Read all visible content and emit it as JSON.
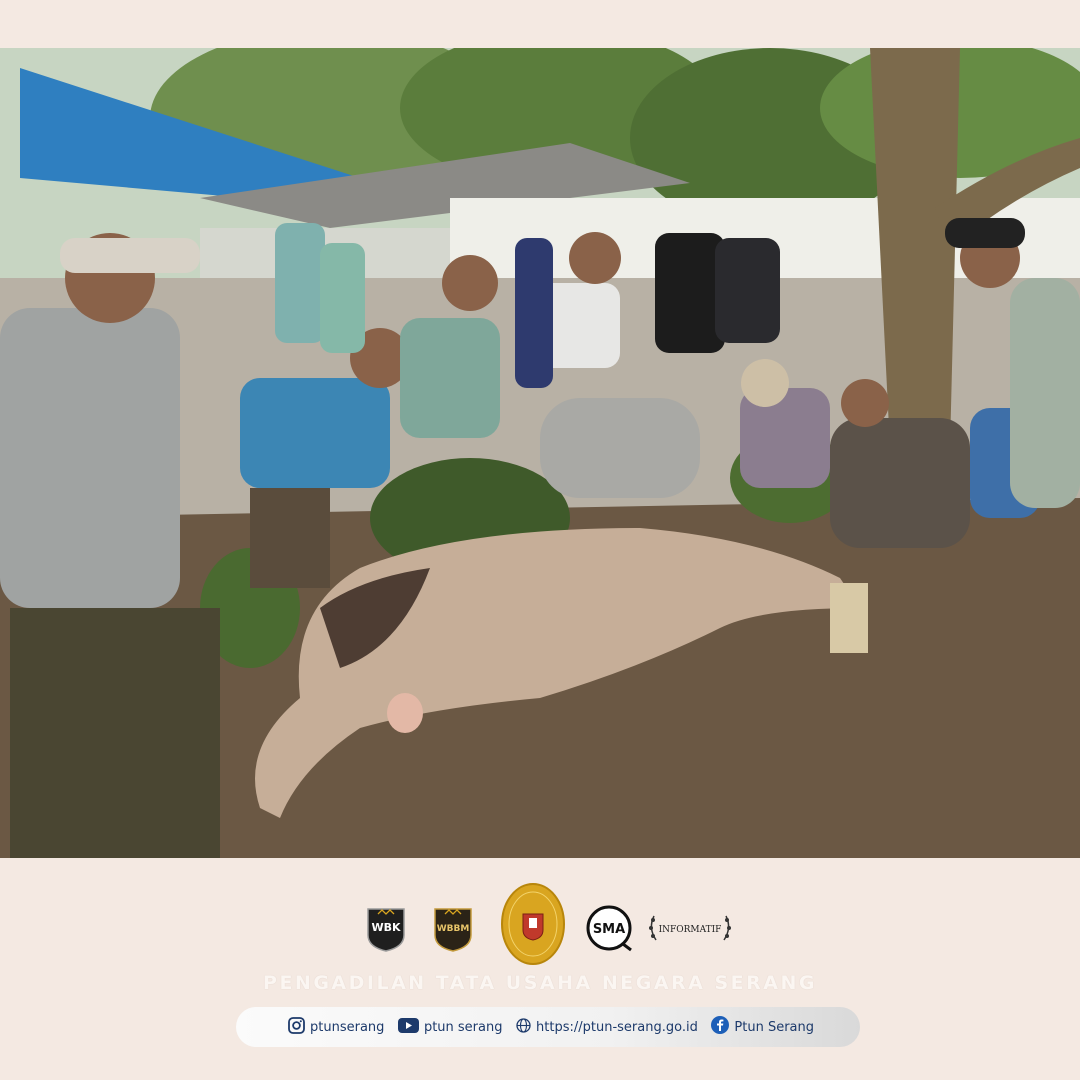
{
  "photo": {
    "subject": "group-photo",
    "accent_colors": {
      "tarp": "#2f7fc0",
      "sky": "#e3ece6",
      "foliage": "#5f7b3c",
      "ground": "#6a5a45",
      "cow": "#c9b3a0"
    }
  },
  "logos": [
    {
      "name": "wbk-badge",
      "text": "WBK"
    },
    {
      "name": "wbbm-badge",
      "text": "WBBM"
    },
    {
      "name": "court-seal",
      "text": ""
    },
    {
      "name": "sma-badge",
      "text": "SMA"
    },
    {
      "name": "informatif-badge",
      "text": "INFORMATIF"
    }
  ],
  "organization": {
    "name": "PENGADILAN TATA USAHA NEGARA SERANG"
  },
  "social": {
    "instagram": {
      "icon": "instagram-icon",
      "label": "ptunserang"
    },
    "youtube": {
      "icon": "youtube-icon",
      "label": "ptun serang"
    },
    "website": {
      "icon": "globe-icon",
      "label": "https://ptun-serang.go.id"
    },
    "facebook": {
      "icon": "facebook-icon",
      "label": "Ptun Serang"
    }
  },
  "colors": {
    "page_bg": "#f4e9e2",
    "link_text": "#1d3a6b",
    "seal_gold": "#d9a520"
  }
}
